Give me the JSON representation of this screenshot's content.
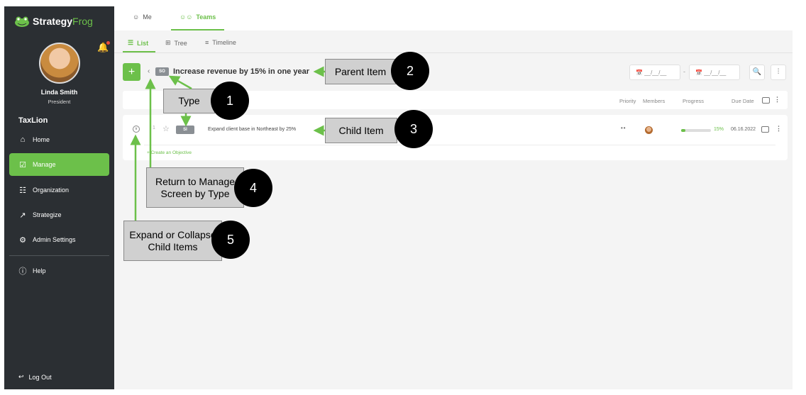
{
  "brand": {
    "name_part1": "Strategy",
    "name_part2": "Frog"
  },
  "user": {
    "name": "Linda Smith",
    "role": "President"
  },
  "org_name": "TaxLion",
  "nav": [
    {
      "label": "Home",
      "icon": "home-icon"
    },
    {
      "label": "Manage",
      "icon": "checkbox-icon"
    },
    {
      "label": "Organization",
      "icon": "org-chart-icon"
    },
    {
      "label": "Strategize",
      "icon": "trend-icon"
    },
    {
      "label": "Admin Settings",
      "icon": "gear-icon"
    },
    {
      "label": "Help",
      "icon": "help-icon"
    }
  ],
  "logout_label": "Log Out",
  "top_tabs": [
    {
      "label": "Me"
    },
    {
      "label": "Teams"
    }
  ],
  "sub_tabs": [
    {
      "label": "List"
    },
    {
      "label": "Tree"
    },
    {
      "label": "Timeline"
    }
  ],
  "parent_item": {
    "type_badge": "SO",
    "title": "Increase revenue by 15% in one year"
  },
  "date_filter": {
    "placeholder": "__/__/__",
    "separator": "-"
  },
  "columns": {
    "priority": "Priority",
    "members": "Members",
    "progress": "Progress",
    "due_date": "Due Date"
  },
  "child_item": {
    "index": "1",
    "type_badge": "SI",
    "title": "Expand client base in Northeast by 25%",
    "priority": "••",
    "progress_percent": 15,
    "progress_text": "15%",
    "due_date": "06.16.2022"
  },
  "create_link": "+ Create an Objective",
  "annotations": [
    {
      "label": "Type",
      "number": "1"
    },
    {
      "label": "Parent Item",
      "number": "2"
    },
    {
      "label": "Child Item",
      "number": "3"
    },
    {
      "label": "Return to Manage Screen by Type",
      "number": "4"
    },
    {
      "label": "Expand or Collapse Child Items",
      "number": "5"
    }
  ],
  "colors": {
    "accent": "#6cc04a",
    "sidebar": "#2b2f33"
  }
}
